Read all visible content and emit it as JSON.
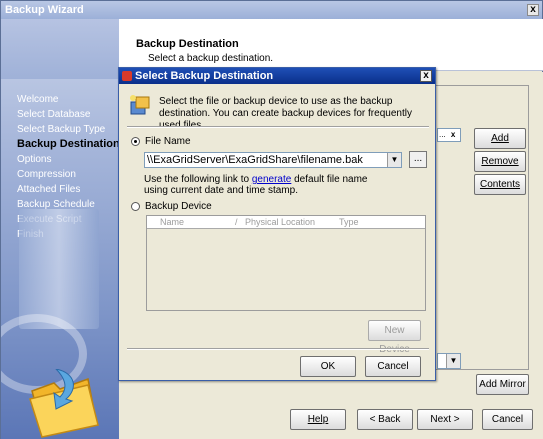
{
  "window": {
    "title": "Backup Wizard",
    "close_label": "x"
  },
  "header": {
    "title": "Backup Destination",
    "subtitle": "Select a backup destination."
  },
  "sidebar": {
    "items": [
      {
        "label": "Welcome",
        "active": false
      },
      {
        "label": "Select Database",
        "active": false
      },
      {
        "label": "Select Backup Type",
        "active": false
      },
      {
        "label": "Backup Destination",
        "active": true
      },
      {
        "label": "Options",
        "active": false
      },
      {
        "label": "Compression",
        "active": false
      },
      {
        "label": "Attached Files",
        "active": false
      },
      {
        "label": "Backup Schedule",
        "active": false
      },
      {
        "label": "Execute Script",
        "active": false
      },
      {
        "label": "Finish",
        "active": false
      }
    ]
  },
  "right_buttons": {
    "add": "Add",
    "remove": "Remove",
    "contents": "Contents",
    "add_mirror": "Add Mirror",
    "small_browse": "...",
    "small_remove": "x"
  },
  "footer": {
    "help": "Help",
    "back": "< Back",
    "next": "Next >",
    "cancel": "Cancel"
  },
  "dialog": {
    "title": "Select Backup Destination",
    "close_label": "x",
    "description": "Select the file or backup device to use as the backup destination. You can create backup devices for frequently used files.",
    "file_name_label": "File Name",
    "file_name_value": "\\\\ExaGridServer\\ExaGridShare\\filename.bak",
    "browse_label": "...",
    "link_text_before": "Use the following link to",
    "link_word": "generate",
    "link_text_after": "default file name using current date and time stamp.",
    "backup_device_label": "Backup Device",
    "columns": [
      "Name",
      "Physical Location",
      "Type"
    ],
    "new_device": "New Device",
    "ok": "OK",
    "cancel": "Cancel"
  },
  "colors": {
    "dialog_title": "#0a2f8a",
    "sidebar": "#7e95c8",
    "link": "#0000cc"
  }
}
